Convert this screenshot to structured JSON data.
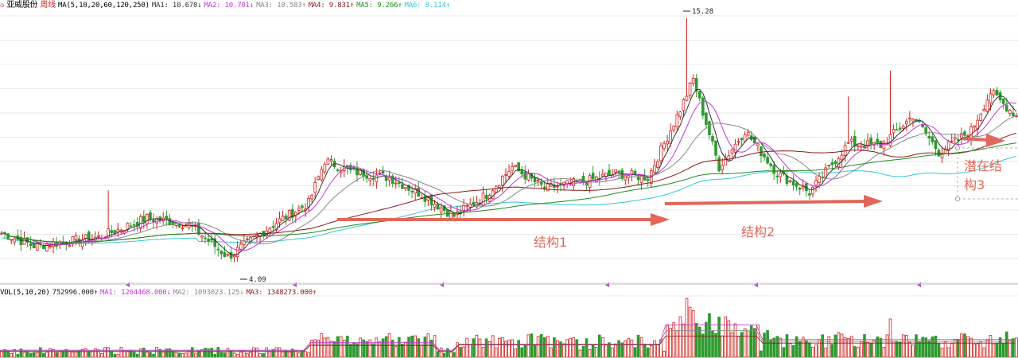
{
  "header": {
    "stock_name": "亚威股份",
    "period": "周线",
    "ma_params_label": "MA(5,10,20,60,120,250)",
    "ma_values": [
      {
        "label": "MA1: 10.670↓",
        "color": "#333333"
      },
      {
        "label": "MA2: 10.701↓",
        "color": "#c23ad6"
      },
      {
        "label": "MA3: 10.583↑",
        "color": "#888888"
      },
      {
        "label": "MA4: 9.831↑",
        "color": "#8b1a1a"
      },
      {
        "label": "MA5: 9.266↑",
        "color": "#228b22"
      },
      {
        "label": "MA6: 8.114↑",
        "color": "#33c7d8"
      }
    ]
  },
  "volume_header": {
    "params_label": "VOL(5,10,20)",
    "vol_value": "752996.000↑",
    "ma_values": [
      {
        "label": "MA1: 1264468.000↓",
        "color": "#c23ad6"
      },
      {
        "label": "MA2: 1093023.125↓",
        "color": "#888888"
      },
      {
        "label": "MA3: 1348273.000↑",
        "color": "#8b1a1a"
      }
    ]
  },
  "chart_data": {
    "type": "candlestick",
    "high_label": "15.28",
    "low_label": "4.09",
    "annotations": [
      "结构1",
      "结构2",
      "潜在结构3"
    ],
    "ohlc_keypoints": [
      {
        "i": 0,
        "close": 5.2
      },
      {
        "i": 10,
        "close": 4.6
      },
      {
        "i": 30,
        "close": 5.0
      },
      {
        "i": 45,
        "close": 5.9
      },
      {
        "i": 58,
        "close": 5.6
      },
      {
        "i": 70,
        "close": 4.09
      },
      {
        "i": 85,
        "close": 5.7
      },
      {
        "i": 95,
        "close": 6.6
      },
      {
        "i": 100,
        "close": 8.6
      },
      {
        "i": 108,
        "close": 8.1
      },
      {
        "i": 120,
        "close": 7.8
      },
      {
        "i": 130,
        "close": 7.0
      },
      {
        "i": 140,
        "close": 6.0
      },
      {
        "i": 150,
        "close": 7.0
      },
      {
        "i": 158,
        "close": 8.3
      },
      {
        "i": 168,
        "close": 7.3
      },
      {
        "i": 180,
        "close": 7.6
      },
      {
        "i": 190,
        "close": 8.0
      },
      {
        "i": 200,
        "close": 7.8
      },
      {
        "i": 210,
        "close": 11.0
      },
      {
        "i": 214,
        "close": 12.4
      },
      {
        "i": 222,
        "close": 8.3
      },
      {
        "i": 230,
        "close": 10.0
      },
      {
        "i": 240,
        "close": 8.0
      },
      {
        "i": 250,
        "close": 7.1
      },
      {
        "i": 262,
        "close": 9.4
      },
      {
        "i": 272,
        "close": 9.3
      },
      {
        "i": 282,
        "close": 10.7
      },
      {
        "i": 290,
        "close": 9.0
      },
      {
        "i": 300,
        "close": 10.0
      },
      {
        "i": 306,
        "close": 11.8
      },
      {
        "i": 314,
        "close": 10.7
      }
    ],
    "ylim": [
      3.0,
      15.6
    ]
  },
  "colors": {
    "up": "#d0211d",
    "down": "#2f9a2f",
    "arrow": "#e0675a",
    "grid": "#e8e8e8"
  }
}
